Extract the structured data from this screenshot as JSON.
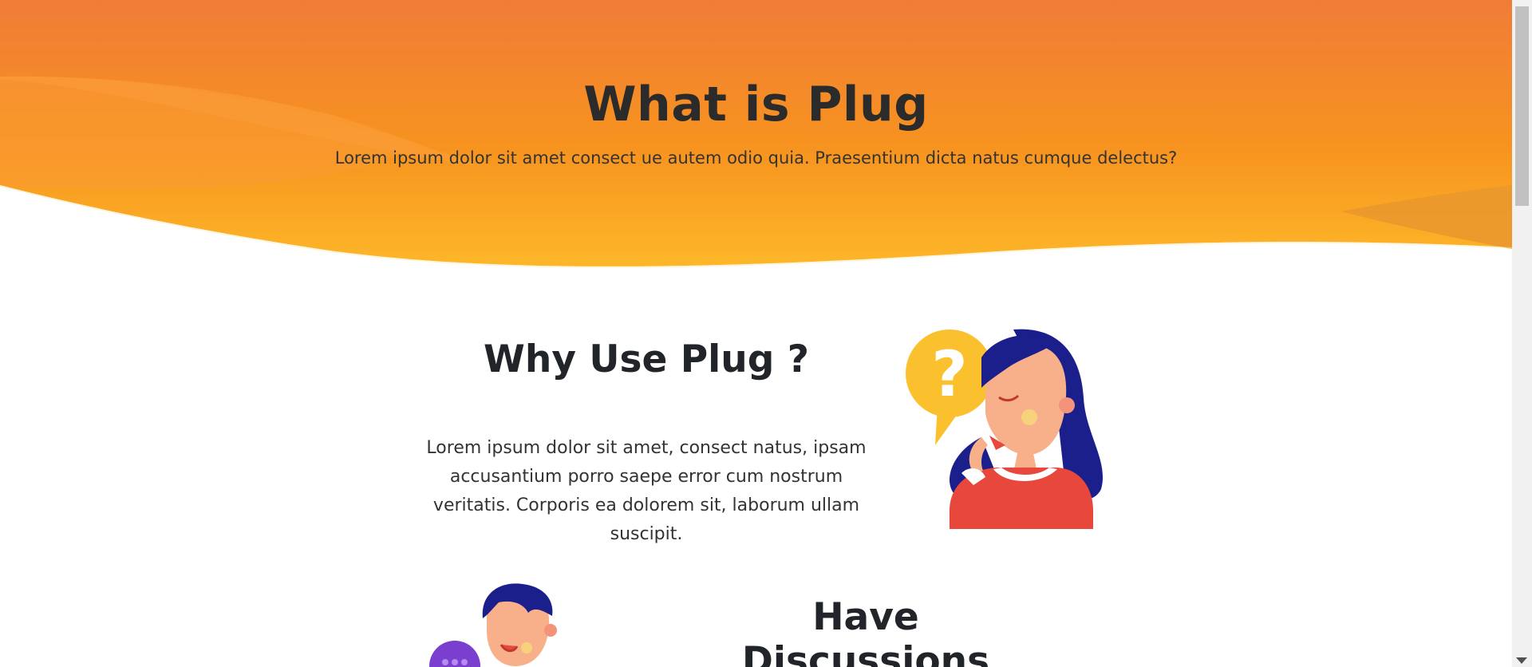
{
  "hero": {
    "title": "What is Plug",
    "subtitle": "Lorem ipsum dolor sit amet consect ue autem odio quia. Praesentium dicta natus cumque delectus?",
    "gradient_top": "#f07c38",
    "gradient_bottom": "#fdb729"
  },
  "why": {
    "title": "Why Use Plug ?",
    "text": "Lorem ipsum dolor sit amet, consect natus, ipsam accusantium porro saepe error cum nostrum veritatis. Corporis ea dolorem sit, laborum ullam suscipit.",
    "illustration": "thinking-woman-icon"
  },
  "discussions": {
    "title": "Have Discussions",
    "illustration": "talking-man-icon"
  },
  "colors": {
    "accent_orange": "#f28a2e",
    "accent_yellow": "#fdb729",
    "hair_navy": "#1a1f8c",
    "shirt_red": "#e8473c",
    "question_yellow": "#fbc02d",
    "bubble_purple": "#7b3fd0"
  }
}
